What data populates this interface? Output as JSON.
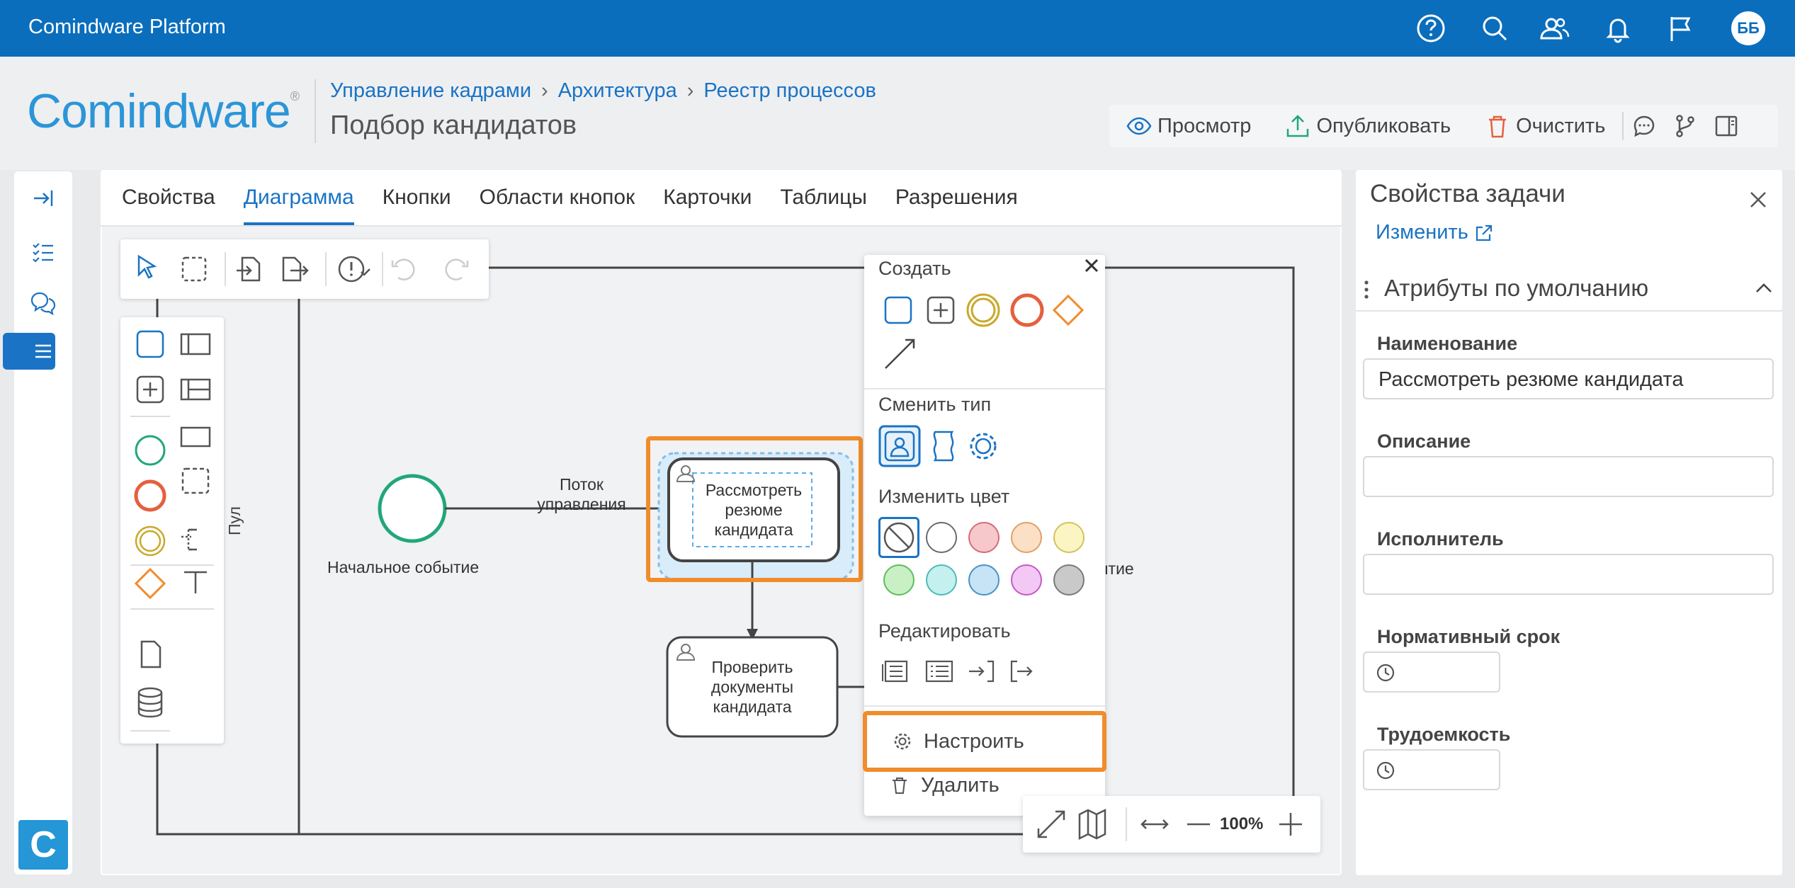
{
  "app": {
    "title": "Comindware Platform",
    "user_initials": "ББ",
    "logo": "Comindware"
  },
  "breadcrumb": {
    "items": [
      "Управление кадрами",
      "Архитектура",
      "Реестр процессов"
    ]
  },
  "page": {
    "title": "Подбор кандидатов"
  },
  "actions": {
    "view": "Просмотр",
    "publish": "Опубликовать",
    "clear": "Очистить"
  },
  "tabs": [
    "Свойства",
    "Диаграмма",
    "Кнопки",
    "Области кнопок",
    "Карточки",
    "Таблицы",
    "Разрешения"
  ],
  "diagram": {
    "pool_label": "Пул",
    "start_event_label": "Начальное событие",
    "flow_label_1": "Поток",
    "flow_label_2": "управления",
    "task1": [
      "Рассмотреть",
      "резюме",
      "кандидата"
    ],
    "task2": [
      "Проверить",
      "документы",
      "кандидата"
    ],
    "end_event_partial": "ытие"
  },
  "context_menu": {
    "create": "Создать",
    "change_type": "Сменить тип",
    "change_color": "Изменить цвет",
    "edit": "Редактировать",
    "configure": "Настроить",
    "delete": "Удалить",
    "colors": [
      "#ffffff",
      "#f6c7cb",
      "#fbe0c6",
      "#fbf5c4",
      "#c9f0c5",
      "#c4f0f0",
      "#c7e3f6",
      "#f3c8f4",
      "#c9c9c9"
    ]
  },
  "zoom": {
    "level": "100%"
  },
  "task_panel": {
    "title": "Свойства задачи",
    "edit_link": "Изменить",
    "section": "Атрибуты по умолчанию",
    "fields": {
      "name_label": "Наименование",
      "name_value": "Рассмотреть резюме кандидата",
      "description_label": "Описание",
      "description_value": "",
      "assignee_label": "Исполнитель",
      "assignee_value": "",
      "deadline_label": "Нормативный срок",
      "effort_label": "Трудоемкость"
    }
  },
  "colors": {
    "accent": "#1a73c4",
    "topbar": "#0a6ebd",
    "highlight": "#f08c2c",
    "start_event": "#21a779",
    "end_event": "#e5603f"
  }
}
